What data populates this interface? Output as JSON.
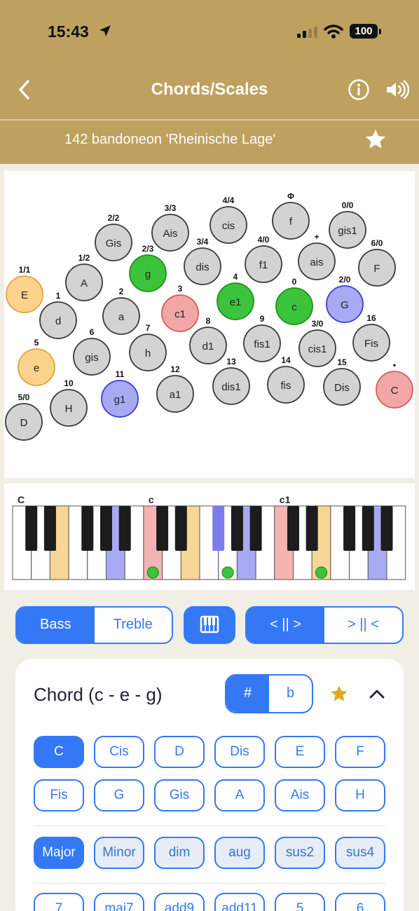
{
  "status_bar": {
    "time": "15:43",
    "battery": "100"
  },
  "nav": {
    "title": "Chords/Scales"
  },
  "instrument": {
    "name": "142 bandoneon 'Rheinische Lage'"
  },
  "colors": {
    "header": "#bfa15f",
    "accent": "#3478f6",
    "green": "#3cc33c",
    "red": "#f2a7a7",
    "orange": "#fbd38d",
    "blue": "#a9a9f3",
    "button_gray": "#d3d3d3"
  },
  "buttons": [
    {
      "note": "E",
      "num": "1/1",
      "state": "orange"
    },
    {
      "note": "A",
      "num": "1/2",
      "state": "none"
    },
    {
      "note": "Gis",
      "num": "2/2",
      "state": "none"
    },
    {
      "note": "Ais",
      "num": "3/3",
      "state": "none"
    },
    {
      "note": "cis",
      "num": "4/4",
      "state": "none"
    },
    {
      "note": "f",
      "num": "Φ",
      "state": "none"
    },
    {
      "note": "gis1",
      "num": "0/0",
      "state": "none"
    },
    {
      "note": "g",
      "num": "2/3",
      "state": "green"
    },
    {
      "note": "dis",
      "num": "3/4",
      "state": "none"
    },
    {
      "note": "f1",
      "num": "4/0",
      "state": "none"
    },
    {
      "note": "ais",
      "num": "+",
      "state": "none"
    },
    {
      "note": "F",
      "num": "6/0",
      "state": "none"
    },
    {
      "note": "d",
      "num": "1",
      "state": "none"
    },
    {
      "note": "a",
      "num": "2",
      "state": "none"
    },
    {
      "note": "c1",
      "num": "3",
      "state": "red"
    },
    {
      "note": "e1",
      "num": "4",
      "state": "green"
    },
    {
      "note": "c",
      "num": "0",
      "state": "green"
    },
    {
      "note": "G",
      "num": "2/0",
      "state": "blue"
    },
    {
      "note": "e",
      "num": "5",
      "state": "orange"
    },
    {
      "note": "gis",
      "num": "6",
      "state": "none"
    },
    {
      "note": "h",
      "num": "7",
      "state": "none"
    },
    {
      "note": "d1",
      "num": "8",
      "state": "none"
    },
    {
      "note": "fis1",
      "num": "9",
      "state": "none"
    },
    {
      "note": "cis1",
      "num": "3/0",
      "state": "none"
    },
    {
      "note": "Fis",
      "num": "16",
      "state": "none"
    },
    {
      "note": "H",
      "num": "10",
      "state": "none"
    },
    {
      "note": "g1",
      "num": "11",
      "state": "blue"
    },
    {
      "note": "a1",
      "num": "12",
      "state": "none"
    },
    {
      "note": "dis1",
      "num": "13",
      "state": "none"
    },
    {
      "note": "fis",
      "num": "14",
      "state": "none"
    },
    {
      "note": "Dis",
      "num": "15",
      "state": "none"
    },
    {
      "note": "C",
      "num": "•",
      "state": "red"
    },
    {
      "note": "D",
      "num": "5/0",
      "state": "none"
    }
  ],
  "keyboard": {
    "octave_labels": [
      "C",
      "c",
      "c1"
    ],
    "white_keys": [
      "none",
      "none",
      "orange",
      "none",
      "none",
      "blue",
      "none",
      "red",
      "none",
      "orange",
      "none",
      "none",
      "blue",
      "none",
      "red",
      "none",
      "orange",
      "none",
      "none",
      "blue",
      "none"
    ],
    "black_keys": [
      "none",
      "none",
      "none",
      "none",
      "none",
      "none",
      "none",
      "blue",
      "none",
      "none",
      "none",
      "none",
      "none",
      "none",
      "none"
    ],
    "markers": [
      7,
      11,
      16
    ]
  },
  "clef": {
    "options": [
      "Bass",
      "Treble"
    ],
    "selected": "Bass"
  },
  "direction": {
    "options": [
      "< || >",
      "> || <"
    ],
    "selected": "< || >"
  },
  "chord": {
    "title": "Chord (c - e - g)",
    "accidentals": [
      "#",
      "b"
    ],
    "selected_accidental": "#",
    "roots": [
      "C",
      "Cis",
      "D",
      "Dis",
      "E",
      "F",
      "Fis",
      "G",
      "Gis",
      "A",
      "Ais",
      "H"
    ],
    "selected_root": "C",
    "types": [
      "Major",
      "Minor",
      "dim",
      "aug",
      "sus2",
      "sus4"
    ],
    "selected_type": "Major",
    "extensions": [
      "7",
      "maj7",
      "add9",
      "add11",
      "5",
      "6"
    ]
  }
}
